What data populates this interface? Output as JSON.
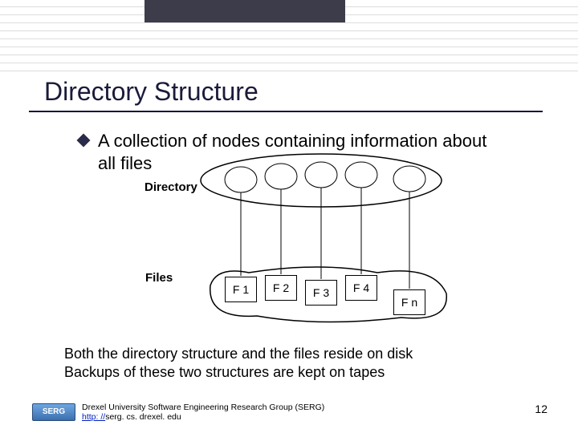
{
  "title": "Directory Structure",
  "bullet": "A collection of nodes containing information about all files",
  "labels": {
    "directory": "Directory",
    "files": "Files"
  },
  "files": {
    "f1": "F 1",
    "f2": "F 2",
    "f3": "F 3",
    "f4": "F 4",
    "fn": "F n"
  },
  "bottom_line1": "Both the directory structure and the files reside on disk",
  "bottom_line2": "Backups of these two structures are kept on tapes",
  "footer": {
    "badge": "SERG",
    "org": "Drexel University Software Engineering Research Group (SERG)",
    "url_prefix": "http: //",
    "url_rest": "serg. cs. drexel. edu"
  },
  "page_number": "12"
}
